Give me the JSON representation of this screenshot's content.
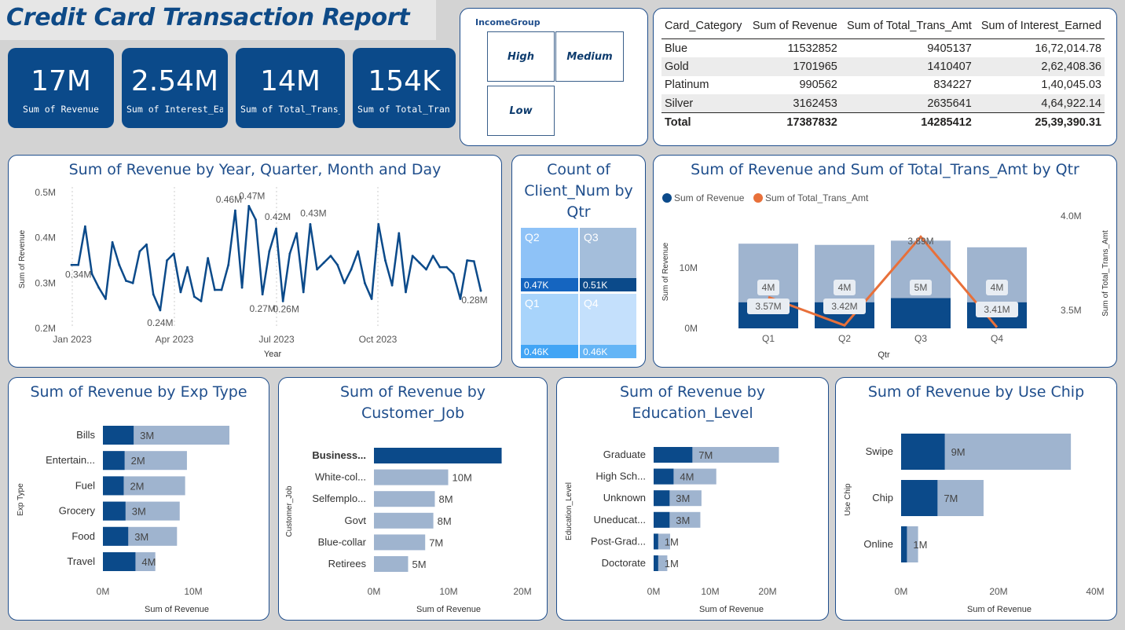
{
  "header": {
    "title": "Credit Card Transaction Report"
  },
  "kpis": [
    {
      "value": "17M",
      "label": "Sum of Revenue"
    },
    {
      "value": "2.54M",
      "label": "Sum of Interest_Earned"
    },
    {
      "value": "14M",
      "label": "Sum of Total_Trans_Amt"
    },
    {
      "value": "154K",
      "label": "Sum of Total_Trans_Ct"
    }
  ],
  "slicer": {
    "title": "IncomeGroup",
    "options": [
      "High",
      "Medium",
      "Low"
    ]
  },
  "matrix": {
    "headers": [
      "Card_Category",
      "Sum of Revenue",
      "Sum of Total_Trans_Amt",
      "Sum of Interest_Earned"
    ],
    "rows": [
      [
        "Blue",
        "11532852",
        "9405137",
        "16,72,014.78"
      ],
      [
        "Gold",
        "1701965",
        "1410407",
        "2,62,408.36"
      ],
      [
        "Platinum",
        "990562",
        "834227",
        "1,40,045.03"
      ],
      [
        "Silver",
        "3162453",
        "2635641",
        "4,64,922.14"
      ]
    ],
    "total": [
      "Total",
      "17387832",
      "14285412",
      "25,39,390.31"
    ]
  },
  "colors": {
    "dark": "#0b4a8a",
    "light": "#9fb4cf",
    "orange": "#e8703a",
    "title": "#1f4e8c"
  },
  "chart_data": [
    {
      "id": "line",
      "type": "line",
      "title": "Sum of Revenue by Year, Quarter, Month and Day",
      "xlabel": "Year",
      "ylabel": "Sum of Revenue",
      "x_ticks": [
        "Jan 2023",
        "Apr 2023",
        "Jul 2023",
        "Oct 2023"
      ],
      "y_ticks": [
        "0.2M",
        "0.3M",
        "0.4M",
        "0.5M"
      ],
      "ylim": [
        0.2,
        0.5
      ],
      "values": [
        0.34,
        0.34,
        0.425,
        0.32,
        0.29,
        0.265,
        0.39,
        0.34,
        0.305,
        0.3,
        0.37,
        0.385,
        0.275,
        0.24,
        0.35,
        0.365,
        0.28,
        0.335,
        0.27,
        0.26,
        0.355,
        0.285,
        0.285,
        0.34,
        0.46,
        0.29,
        0.47,
        0.44,
        0.275,
        0.37,
        0.42,
        0.26,
        0.365,
        0.41,
        0.28,
        0.43,
        0.33,
        0.345,
        0.36,
        0.34,
        0.3,
        0.33,
        0.37,
        0.3,
        0.265,
        0.43,
        0.35,
        0.295,
        0.41,
        0.28,
        0.36,
        0.345,
        0.33,
        0.36,
        0.335,
        0.335,
        0.32,
        0.265,
        0.35,
        0.348,
        0.283
      ],
      "point_labels": [
        "0.34M",
        "0.24M",
        "0.46M",
        "0.47M",
        "0.27M",
        "0.42M",
        "0.26M",
        "0.43M",
        "0.28M"
      ]
    },
    {
      "id": "treemap",
      "type": "treemap",
      "title": "Count of Client_Num by Qtr",
      "categories": [
        "Q2",
        "Q3",
        "Q1",
        "Q4"
      ],
      "values": [
        "0.47K",
        "0.51K",
        "0.46K",
        "0.46K"
      ]
    },
    {
      "id": "combo",
      "type": "bar",
      "title": "Sum of Revenue and Sum of Total_Trans_Amt by Qtr",
      "xlabel": "Qtr",
      "ylabel": "Sum of Revenue",
      "y2label": "Sum of Total_Trans_Amt",
      "y_ticks": [
        "0M",
        "10M"
      ],
      "y2_ticks": [
        "3.5M",
        "4.0M"
      ],
      "categories": [
        "Q1",
        "Q2",
        "Q3",
        "Q4"
      ],
      "series": [
        {
          "name": "Sum of Revenue",
          "values": [
            4.3,
            4.3,
            5.0,
            4.3
          ],
          "labels": [
            "4M",
            "4M",
            "5M",
            "4M"
          ]
        },
        {
          "name": "Sum of Total_Trans_Amt",
          "values": [
            3.57,
            3.42,
            3.89,
            3.41
          ],
          "labels": [
            "3.57M",
            "3.42M",
            "3.89M",
            "3.41M"
          ]
        }
      ]
    },
    {
      "id": "exp",
      "type": "bar",
      "title": "Sum of Revenue by Exp Type",
      "xlabel": "Sum of Revenue",
      "ylabel": "Exp Type",
      "x_ticks": [
        "0M",
        "10M"
      ],
      "categories": [
        "Bills",
        "Entertain...",
        "Fuel",
        "Grocery",
        "Food",
        "Travel"
      ],
      "values": [
        3.4,
        2.4,
        2.3,
        2.1,
        2.0,
        1.5
      ],
      "labels": [
        "3M",
        "2M",
        "2M",
        "3M",
        "3M",
        "4M"
      ]
    },
    {
      "id": "job",
      "type": "bar",
      "title": "Sum of Revenue by Customer_Job",
      "xlabel": "Sum of Revenue",
      "ylabel": "Customer_Job",
      "x_ticks": [
        "0M",
        "10M",
        "20M"
      ],
      "categories": [
        "Business...",
        "White-col...",
        "Selfemplo...",
        "Govt",
        "Blue-collar",
        "Retirees"
      ],
      "values": [
        17,
        10,
        8,
        8,
        7,
        5
      ],
      "labels": [
        "17M",
        "10M",
        "8M",
        "8M",
        "7M",
        "5M"
      ]
    },
    {
      "id": "edu",
      "type": "bar",
      "title": "Sum of Revenue by Education_Level",
      "xlabel": "Sum of Revenue",
      "ylabel": "Education_Level",
      "x_ticks": [
        "0M",
        "10M",
        "20M"
      ],
      "categories": [
        "Graduate",
        "High Sch...",
        "Unknown",
        "Uneducat...",
        "Post-Grad...",
        "Doctorate"
      ],
      "values": [
        7,
        4,
        3,
        3,
        1,
        1
      ],
      "labels": [
        "7M",
        "4M",
        "3M",
        "3M",
        "1M",
        "1M"
      ]
    },
    {
      "id": "chip",
      "type": "bar",
      "title": "Sum of Revenue by Use Chip",
      "xlabel": "Sum of Revenue",
      "ylabel": "Use Chip",
      "x_ticks": [
        "0M",
        "20M",
        "40M"
      ],
      "categories": [
        "Swipe",
        "Chip",
        "Online"
      ],
      "values": [
        9,
        7,
        1
      ],
      "labels": [
        "9M",
        "7M",
        "1M"
      ]
    }
  ]
}
